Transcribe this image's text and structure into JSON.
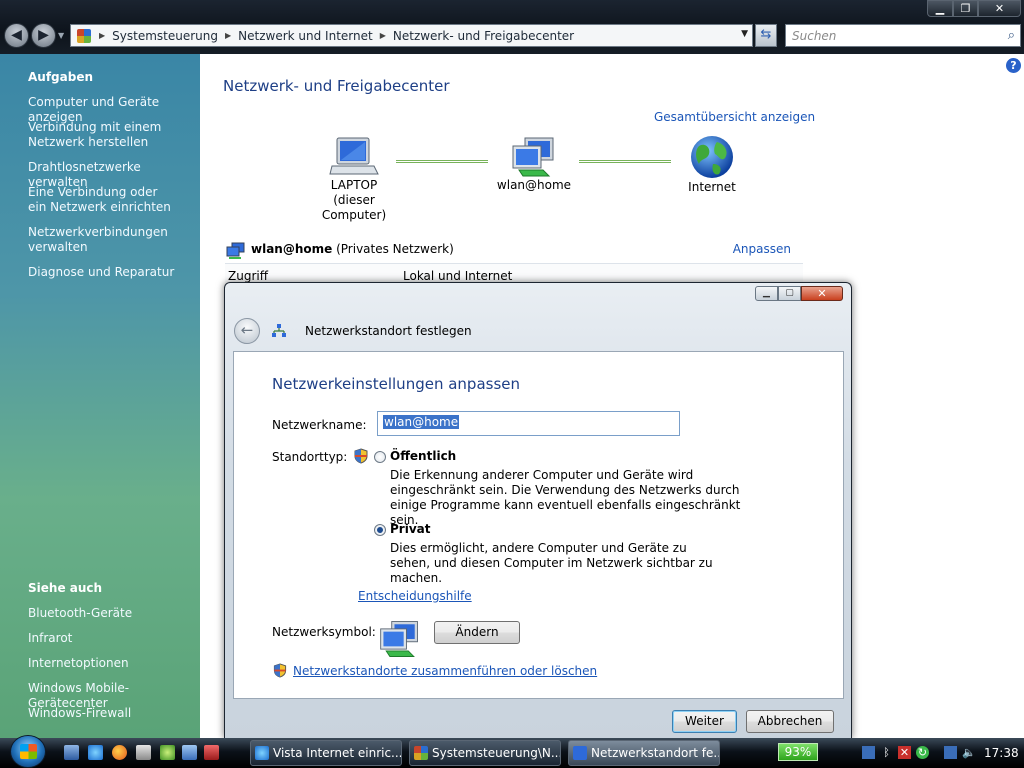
{
  "window": {
    "min_label": "▁",
    "max_label": "❐",
    "close_label": "✕"
  },
  "nav": {
    "back_label": "◀",
    "forward_label": "▶",
    "dropdown_label": "▼"
  },
  "address": {
    "crumbs": [
      "Systemsteuerung",
      "Netzwerk und Internet",
      "Netzwerk- und Freigabecenter"
    ],
    "separator": "▶",
    "dropdown_label": "▼",
    "refresh_label": "⇆"
  },
  "search": {
    "placeholder": "Suchen",
    "icon": "search-icon"
  },
  "sidebar": {
    "tasks_heading": "Aufgaben",
    "tasks": [
      "Computer und Geräte anzeigen",
      "Verbindung mit einem Netzwerk herstellen",
      "Drahtlosnetzwerke verwalten",
      "Eine Verbindung oder ein Netzwerk einrichten",
      "Netzwerkverbindungen verwalten",
      "Diagnose und Reparatur"
    ],
    "see_also_heading": "Siehe auch",
    "see_also": [
      "Bluetooth-Geräte",
      "Infrarot",
      "Internetoptionen",
      "Windows Mobile-Gerätecenter",
      "Windows-Firewall"
    ]
  },
  "main": {
    "title": "Netzwerk- und Freigabecenter",
    "help_label": "?",
    "full_map_link": "Gesamtübersicht anzeigen",
    "map": {
      "computer_name": "LAPTOP",
      "computer_sub": "(dieser Computer)",
      "network_name": "wlan@home",
      "internet_label": "Internet"
    },
    "network_bold": "wlan@home",
    "network_type": " (Privates Netzwerk)",
    "customize_link": "Anpassen",
    "access_label": "Zugriff",
    "access_value": "Lokal und Internet"
  },
  "dialog": {
    "window_title": "Netzwerkstandort festlegen",
    "back_label": "←",
    "heading": "Netzwerkeinstellungen anpassen",
    "name_label": "Netzwerkname:",
    "name_value": "wlan@home",
    "location_label": "Standorttyp:",
    "public_option": "Öffentlich",
    "public_desc": "Die Erkennung anderer Computer und Geräte wird eingeschränkt sein. Die Verwendung des Netzwerks durch einige Programme kann eventuell ebenfalls eingeschränkt sein.",
    "private_option": "Privat",
    "private_desc": "Dies ermöglicht, andere Computer und Geräte zu sehen, und diesen Computer im Netzwerk sichtbar zu machen.",
    "selected_option": "Privat",
    "help_link": "Entscheidungshilfe",
    "icon_label": "Netzwerksymbol:",
    "change_button": "Ändern",
    "merge_link": "Netzwerkstandorte zusammenführen oder löschen",
    "next_button": "Weiter",
    "cancel_button": "Abbrechen",
    "min_label": "▁",
    "max_label": "▢",
    "close_label": "✕"
  },
  "taskbar": {
    "tasks": [
      "Vista Internet einric...",
      "Systemsteuerung\\N...",
      "Netzwerkstandort fe..."
    ],
    "active_task": "Netzwerkstandort fe...",
    "battery": "93%",
    "clock": "17:38"
  },
  "colors": {
    "link": "#1b56b8",
    "title": "#1e3f86",
    "sidebar_top": "#3a86a6",
    "sidebar_bottom": "#5aa377"
  }
}
